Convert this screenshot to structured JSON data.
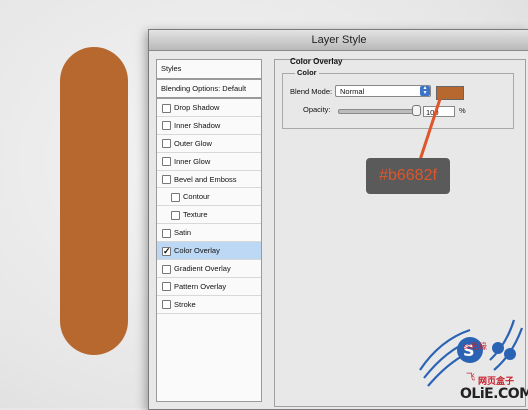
{
  "canvas": {
    "shape_color": "#b6682f"
  },
  "dialog": {
    "title": "Layer Style"
  },
  "left_panel": {
    "styles_header": "Styles",
    "blending_options": "Blending Options: Default",
    "items": [
      {
        "label": "Drop Shadow",
        "checked": false,
        "indent": false,
        "selected": false
      },
      {
        "label": "Inner Shadow",
        "checked": false,
        "indent": false,
        "selected": false
      },
      {
        "label": "Outer Glow",
        "checked": false,
        "indent": false,
        "selected": false
      },
      {
        "label": "Inner Glow",
        "checked": false,
        "indent": false,
        "selected": false
      },
      {
        "label": "Bevel and Emboss",
        "checked": false,
        "indent": false,
        "selected": false
      },
      {
        "label": "Contour",
        "checked": false,
        "indent": true,
        "selected": false
      },
      {
        "label": "Texture",
        "checked": false,
        "indent": true,
        "selected": false
      },
      {
        "label": "Satin",
        "checked": false,
        "indent": false,
        "selected": false
      },
      {
        "label": "Color Overlay",
        "checked": true,
        "indent": false,
        "selected": true
      },
      {
        "label": "Gradient Overlay",
        "checked": false,
        "indent": false,
        "selected": false
      },
      {
        "label": "Pattern Overlay",
        "checked": false,
        "indent": false,
        "selected": false
      },
      {
        "label": "Stroke",
        "checked": false,
        "indent": false,
        "selected": false
      }
    ]
  },
  "color_overlay": {
    "section_title": "Color Overlay",
    "group_title": "Color",
    "blend_mode_label": "Blend Mode:",
    "blend_mode_value": "Normal",
    "swatch_color": "#b6682f",
    "opacity_label": "Opacity:",
    "opacity_value": "100",
    "opacity_unit": "%"
  },
  "callout": {
    "text": "#b6682f",
    "text_color": "#e0552a"
  },
  "watermark": {
    "brand_cn": "飞",
    "sub_cn": "ss思缘",
    "site": "OLiE.COM",
    "cn_text": "网页盒子"
  }
}
